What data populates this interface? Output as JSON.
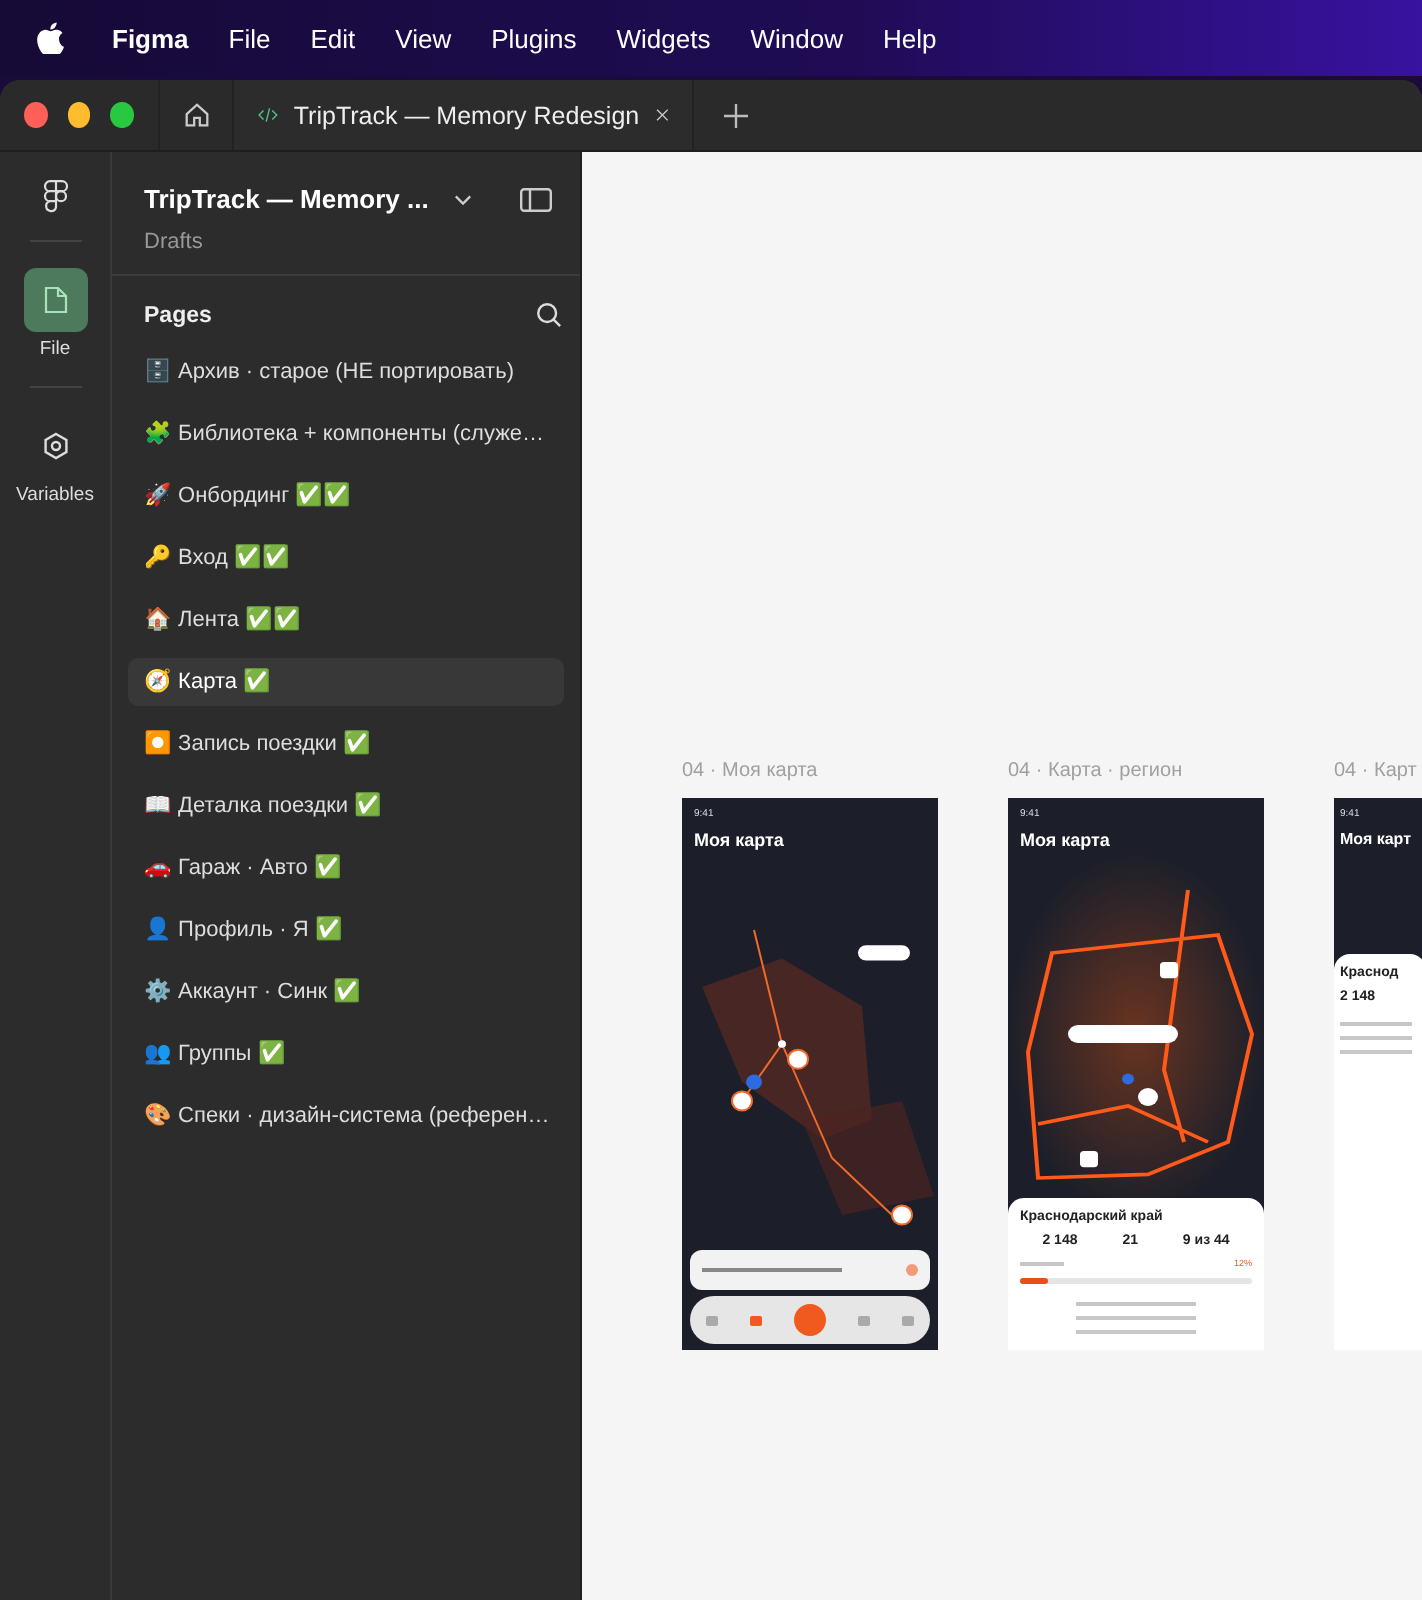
{
  "menu_bar": {
    "app": "Figma",
    "items": [
      "File",
      "Edit",
      "View",
      "Plugins",
      "Widgets",
      "Window",
      "Help"
    ]
  },
  "file_tab": {
    "title": "TripTrack — Memory Redesign"
  },
  "rail": [
    {
      "kind": "file",
      "label": "File",
      "selected": true
    },
    {
      "kind": "variables",
      "label": "Variables",
      "selected": false
    }
  ],
  "sidebar": {
    "title": "TripTrack — Memory ...",
    "subtitle": "Drafts",
    "pages_heading": "Pages",
    "pages": [
      {
        "name": "🗄️ Архив · старое (НЕ портировать)",
        "selected": false
      },
      {
        "name": "🧩 Библиотека + компоненты (служе…",
        "selected": false
      },
      {
        "name": "🚀 Онбординг ✅✅",
        "selected": false
      },
      {
        "name": "🔑 Вход ✅✅",
        "selected": false
      },
      {
        "name": "🏠 Лента ✅✅",
        "selected": false
      },
      {
        "name": "🧭 Карта ✅",
        "selected": true
      },
      {
        "name": "⏺️ Запись поездки ✅",
        "selected": false
      },
      {
        "name": "📖 Деталка поездки ✅",
        "selected": false
      },
      {
        "name": "🚗 Гараж · Авто ✅",
        "selected": false
      },
      {
        "name": "👤 Профиль · Я ✅",
        "selected": false
      },
      {
        "name": "⚙️ Аккаунт · Синк ✅",
        "selected": false
      },
      {
        "name": "👥 Группы ✅",
        "selected": false
      },
      {
        "name": "🎨 Спеки · дизайн-система (референ…",
        "selected": false
      }
    ]
  },
  "canvas": {
    "frames": [
      {
        "label": "04 · Моя карта",
        "kind": "route",
        "time": "9:41",
        "title": "Моя карта"
      },
      {
        "label": "04 · Карта · регион",
        "kind": "region",
        "time": "9:41",
        "title": "Моя карта",
        "sheet": {
          "title": "Краснодарский край",
          "stats": [
            "2 148",
            "21",
            "9 из 44"
          ],
          "level": 0.12,
          "reading": "12%"
        }
      },
      {
        "label": "04 · Карт",
        "kind": "list",
        "time": "9:41",
        "title": "Моя карт",
        "sheet": {
          "title": "Краснод",
          "stats": [
            "2 148"
          ]
        }
      }
    ]
  }
}
